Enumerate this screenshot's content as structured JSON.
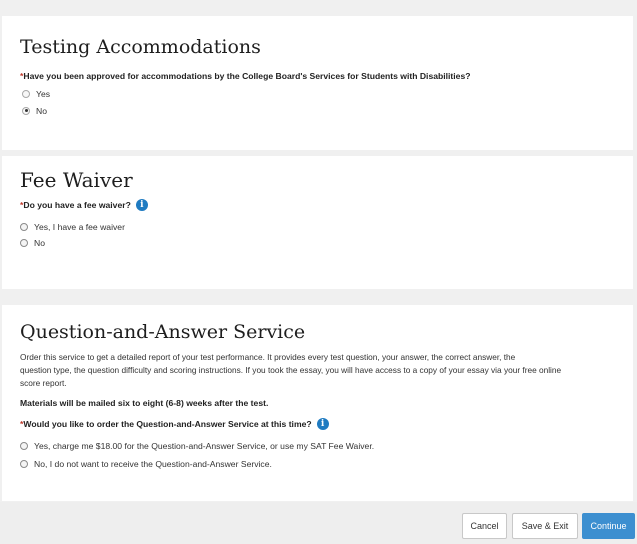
{
  "testing": {
    "title": "Testing Accommodations",
    "required_mark": "*",
    "question": "Have you been approved for accommodations by the College Board's Services for Students with Disabilities?",
    "options": [
      {
        "label": "Yes",
        "selected": false
      },
      {
        "label": "No",
        "selected": true
      }
    ]
  },
  "fee_waiver": {
    "title": "Fee Waiver",
    "required_mark": "*",
    "question": "Do you have a fee waiver?",
    "info_icon": "i",
    "options": [
      {
        "label": "Yes, I have a fee waiver",
        "selected": false
      },
      {
        "label": "No",
        "selected": false
      }
    ]
  },
  "qas": {
    "title": "Question-and-Answer Service",
    "description_lines": [
      "Order this service to get a detailed report of your test performance. It provides every test question, your answer, the correct answer, the",
      "question type, the question difficulty and scoring instructions. If you took the essay, you will have access to a copy of your essay via your free online",
      "score report."
    ],
    "mail_note": "Materials will be mailed six to eight (6-8) weeks after the test.",
    "required_mark": "*",
    "question": "Would you like to order the Question-and-Answer Service at this time?",
    "info_icon": "i",
    "options": [
      {
        "label": "Yes, charge me $18.00 for the Question-and-Answer Service, or use my SAT Fee Waiver.",
        "selected": false
      },
      {
        "label": "No, I do not want to receive the Question-and-Answer Service.",
        "selected": false
      }
    ]
  },
  "footer": {
    "cancel": "Cancel",
    "save_exit": "Save & Exit",
    "continue": "Continue"
  },
  "colors": {
    "primary": "#3c8fd0",
    "info": "#1f7bc1",
    "required": "#c0392b"
  }
}
